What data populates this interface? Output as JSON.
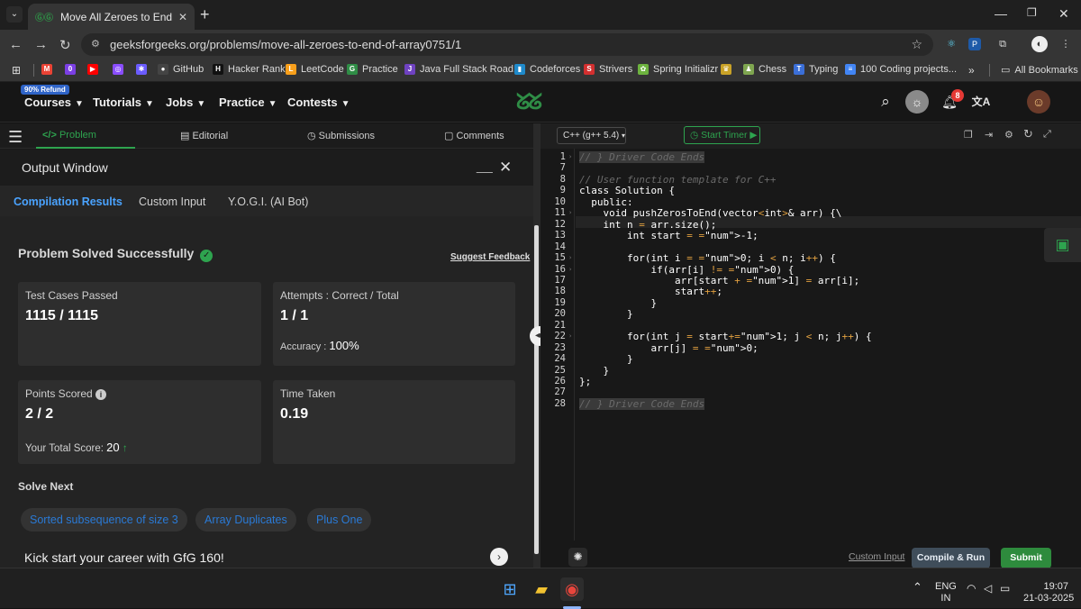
{
  "browser": {
    "tab_title": "Move All Zeroes to End | Practice",
    "url": "geeksforgeeks.org/problems/move-all-zeroes-to-end-of-array0751/1",
    "extension_badge": "8"
  },
  "bookmarks": [
    {
      "label": "",
      "icon": "gmail-icon",
      "color": "#ea4335",
      "glyph": "M"
    },
    {
      "label": "",
      "icon": "ext-icon",
      "color": "#7b3fe4",
      "glyph": "0"
    },
    {
      "label": "",
      "icon": "youtube-icon",
      "color": "#ff0000",
      "glyph": "▶"
    },
    {
      "label": "",
      "icon": "purple-icon",
      "color": "#8a4dff",
      "glyph": "◎"
    },
    {
      "label": "",
      "icon": "gear-purple-icon",
      "color": "#6b5cff",
      "glyph": "✱"
    },
    {
      "label": "GitHub",
      "icon": "github-icon",
      "color": "#444",
      "glyph": "●"
    },
    {
      "label": "Hacker Rank",
      "icon": "hackerrank-icon",
      "color": "#111",
      "glyph": "H"
    },
    {
      "label": "LeetCode",
      "icon": "leetcode-icon",
      "color": "#f89f1b",
      "glyph": "L"
    },
    {
      "label": "Practice",
      "icon": "gfg-icon",
      "color": "#2f8d46",
      "glyph": "G"
    },
    {
      "label": "Java Full Stack Road...",
      "icon": "java-icon",
      "color": "#6f42c1",
      "glyph": "J"
    },
    {
      "label": "Codeforces",
      "icon": "codeforces-icon",
      "color": "#1f8acb",
      "glyph": "▮"
    },
    {
      "label": "Strivers",
      "icon": "strivers-icon",
      "color": "#d32f2f",
      "glyph": "S"
    },
    {
      "label": "Spring Initializr",
      "icon": "spring-icon",
      "color": "#6db33f",
      "glyph": "✿"
    },
    {
      "label": "",
      "icon": "misc-icon",
      "color": "#c9a227",
      "glyph": "♛"
    },
    {
      "label": "Chess",
      "icon": "chess-icon",
      "color": "#7fa650",
      "glyph": "♟"
    },
    {
      "label": "Typing",
      "icon": "typing-icon",
      "color": "#3b6fd8",
      "glyph": "T"
    },
    {
      "label": "100 Coding projects...",
      "icon": "docs-icon",
      "color": "#4285f4",
      "glyph": "≡"
    }
  ],
  "all_bookmarks": "All Bookmarks",
  "gfg_nav": {
    "refund_badge": "90% Refund",
    "items": [
      "Courses",
      "Tutorials",
      "Jobs",
      "Practice",
      "Contests"
    ],
    "notification_count": "8"
  },
  "problem_tabs": [
    "Problem",
    "Editorial",
    "Submissions",
    "Comments"
  ],
  "output_window": {
    "title": "Output Window",
    "tabs": [
      "Compilation Results",
      "Custom Input",
      "Y.O.G.I. (AI Bot)"
    ],
    "status": "Problem Solved Successfully",
    "suggest_feedback": "Suggest Feedback",
    "test_cases": {
      "label": "Test Cases Passed",
      "value": "1115 / 1115"
    },
    "attempts": {
      "label": "Attempts : Correct / Total",
      "value": "1 / 1",
      "accuracy_label": "Accuracy :",
      "accuracy_value": "100%"
    },
    "points": {
      "label": "Points Scored",
      "value": "2 / 2",
      "total_label": "Your Total Score:",
      "total_value": "20"
    },
    "time": {
      "label": "Time Taken",
      "value": "0.19"
    },
    "solve_next_title": "Solve Next",
    "solve_next": [
      "Sorted subsequence of size 3",
      "Array Duplicates",
      "Plus One"
    ],
    "gfg160_banner": "Kick start your career with GfG 160!"
  },
  "editor": {
    "language": "C++ (g++ 5.4)",
    "timer_label": "Start Timer",
    "custom_input": "Custom Input",
    "compile_run": "Compile & Run",
    "submit": "Submit",
    "line_numbers": [
      "1",
      "7",
      "8",
      "9",
      "10",
      "11",
      "12",
      "13",
      "14",
      "15",
      "16",
      "17",
      "18",
      "19",
      "20",
      "21",
      "22",
      "23",
      "24",
      "25",
      "26",
      "27",
      "28"
    ],
    "lines": [
      "// } Driver Code Ends",
      "",
      "// User function template for C++",
      "class Solution {",
      "  public:",
      "    void pushZerosToEnd(vector<int>& arr) {\\",
      "    int n = arr.size();",
      "        int start = -1;",
      "",
      "        for(int i = 0; i < n; i++) {",
      "            if(arr[i] != 0) {",
      "                arr[start + 1] = arr[i];",
      "                start++;",
      "            }",
      "        }",
      "",
      "        for(int j = start+1; j < n; j++) {",
      "            arr[j] = 0;",
      "        }",
      "    }",
      "};",
      "",
      "// } Driver Code Ends"
    ]
  },
  "taskbar": {
    "lang_top": "ENG",
    "lang_bottom": "IN",
    "time": "19:07",
    "date": "21-03-2025"
  }
}
